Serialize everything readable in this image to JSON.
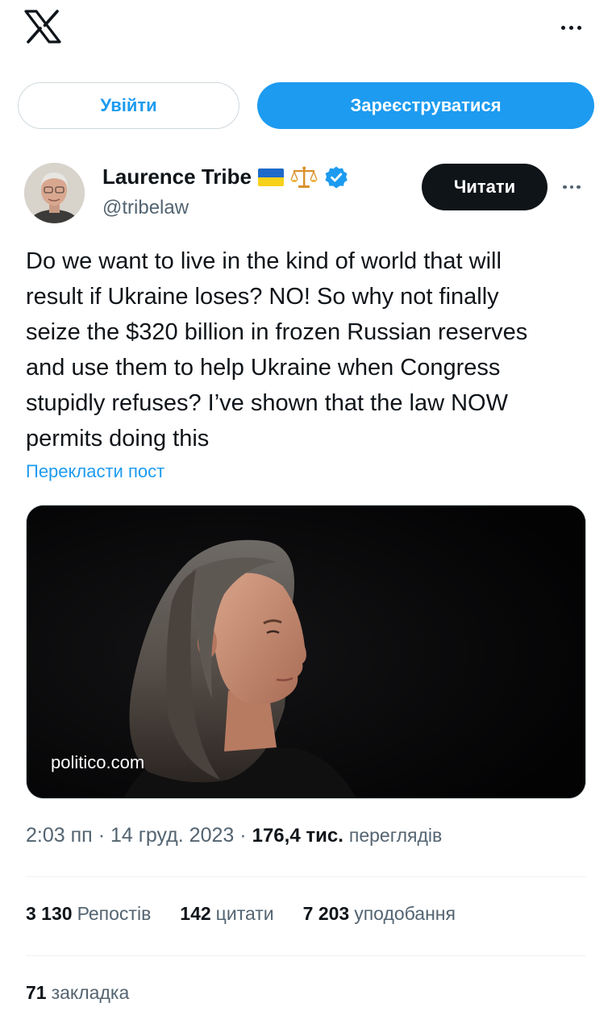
{
  "header": {
    "logo_icon": "x-logo-icon",
    "more_icon": "more-horizontal-icon"
  },
  "auth": {
    "login_label": "Увійти",
    "signup_label": "Зареєструватися"
  },
  "author": {
    "name": "Laurence Tribe",
    "handle": "@tribelaw",
    "badges": [
      "ukraine-flag-icon",
      "scales-icon",
      "verified-badge-icon"
    ],
    "follow_label": "Читати"
  },
  "tweet": {
    "text": "Do we want to live in the kind of world that will\nresult if Ukraine loses? NO! So why not finally\nseize the $320 billion in frozen Russian reserves\nand use them to help Ukraine when Congress\nstupidly refuses? I’ve shown that the law NOW\npermits doing this",
    "translate_label": "Перекласти пост",
    "media_domain": "politico.com"
  },
  "meta": {
    "time": "2:03 пп",
    "sep1": "·",
    "date": "14 груд. 2023",
    "sep2": "·",
    "views_count": "176,4 тис.",
    "views_label": "переглядів"
  },
  "stats": {
    "reposts_count": "3 130",
    "reposts_label": "Репостів",
    "quotes_count": "142",
    "quotes_label": "цитати",
    "likes_count": "7 203",
    "likes_label": "уподобання",
    "bookmarks_count": "71",
    "bookmarks_label": "закладка"
  },
  "colors": {
    "accent": "#1d9bf0",
    "text_primary": "#0f1419",
    "text_secondary": "#536471",
    "border": "#cfd9de"
  }
}
